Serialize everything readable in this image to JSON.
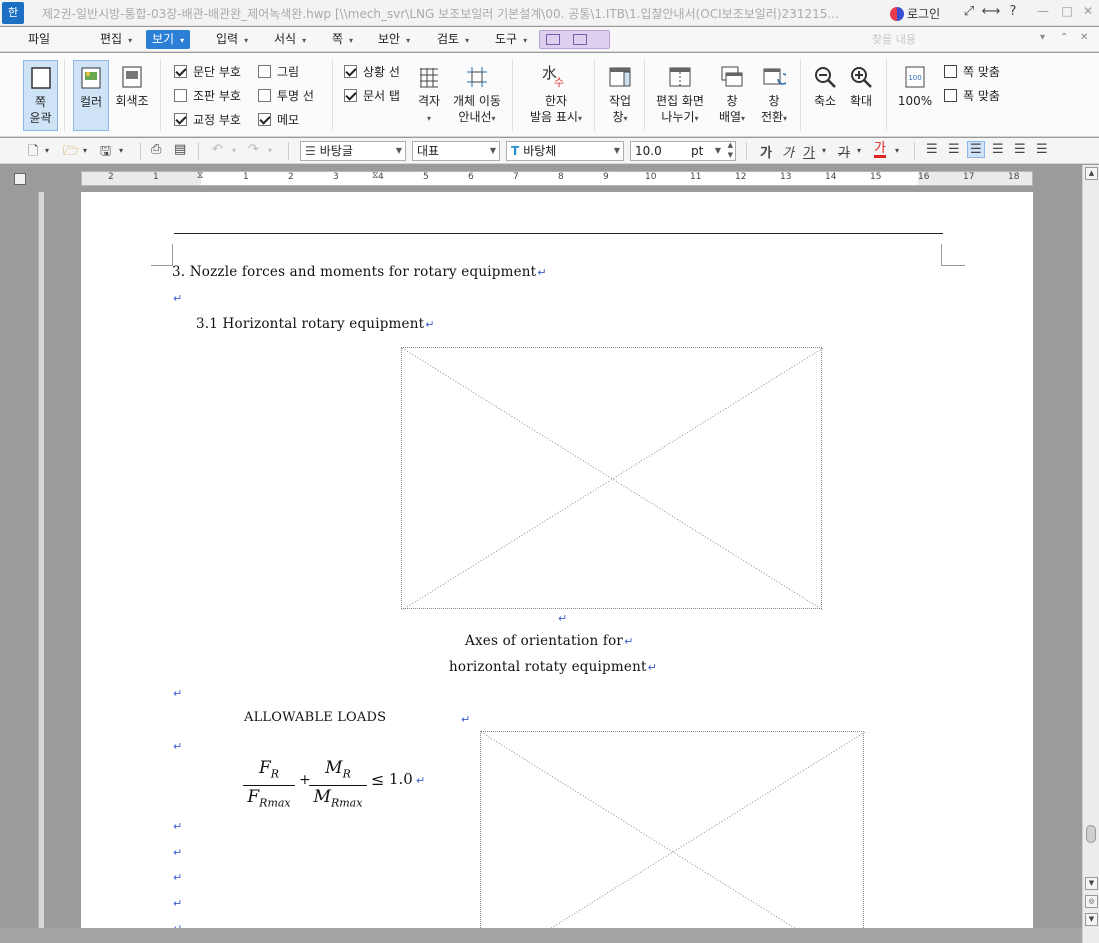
{
  "window": {
    "app_icon": "한",
    "title": "제2권-일반시방-통합-03장-배관-배관완_제어녹색완.hwp [\\\\mech_svr\\LNG 보조보일러 기본설계\\00. 공통\\1.ITB\\1.입찰안내서(OCI보조보일러)231215...",
    "login": "로그인",
    "controls": [
      "⤢",
      "⟷",
      "?"
    ],
    "window_buttons": [
      "—",
      "□",
      "✕"
    ]
  },
  "menubar": {
    "items": [
      {
        "label": "파일",
        "arrow": ""
      },
      {
        "label": "편집",
        "arrow": "▾"
      },
      {
        "label": "보기",
        "arrow": "▾"
      },
      {
        "label": "입력",
        "arrow": "▾"
      },
      {
        "label": "서식",
        "arrow": "▾"
      },
      {
        "label": "쪽",
        "arrow": "▾"
      },
      {
        "label": "보안",
        "arrow": "▾"
      },
      {
        "label": "검토",
        "arrow": "▾"
      },
      {
        "label": "도구",
        "arrow": "▾"
      }
    ],
    "search_placeholder": "찾을 내용",
    "ribbon_toggle": [
      "▾",
      "⌃",
      "✕"
    ]
  },
  "ribbon": {
    "page_outline": {
      "line1": "쪽",
      "line2": "윤곽"
    },
    "color": "컬러",
    "grayscale": "회색조",
    "checks_col1": [
      {
        "label": "문단 부호",
        "checked": true
      },
      {
        "label": "조판 부호",
        "checked": false
      },
      {
        "label": "교정 부호",
        "checked": true
      }
    ],
    "checks_col2": [
      {
        "label": "그림",
        "checked": false
      },
      {
        "label": "투명 선",
        "checked": false
      },
      {
        "label": "메모",
        "checked": true
      }
    ],
    "checks_col3": [
      {
        "label": "상황 선",
        "checked": true
      },
      {
        "label": "문서 탭",
        "checked": true
      }
    ],
    "grid": "격자",
    "obj_move": {
      "line1": "개체 이동",
      "line2": "안내선"
    },
    "hanja": {
      "line1": "한자",
      "line2": "발음 표시"
    },
    "hanja_glyph": "水",
    "hanja_sub": "수",
    "task_pane": {
      "line1": "작업",
      "line2": "창"
    },
    "split_view": {
      "line1": "편집 화면",
      "line2": "나누기"
    },
    "arrange": {
      "line1": "창",
      "line2": "배열"
    },
    "switch": {
      "line1": "창",
      "line2": "전환"
    },
    "zoom_out": "축소",
    "zoom_in": "확대",
    "zoom_level": "100%",
    "fit_page": "쪽 맞춤",
    "fit_width": "폭 맞춤"
  },
  "format_toolbar": {
    "style": "바탕글",
    "lang": "대표",
    "font": "바탕체",
    "size": "10.0",
    "unit": "pt",
    "bold": "가",
    "italic": "가",
    "underline": "가",
    "strike": "가",
    "font_color": "가"
  },
  "ruler": {
    "numbers": [
      "2",
      "1",
      "1",
      "2",
      "3",
      "4",
      "5",
      "6",
      "7",
      "8",
      "9",
      "10",
      "11",
      "12",
      "13",
      "14",
      "15",
      "16",
      "17",
      "18"
    ]
  },
  "document": {
    "heading": "3. Nozzle forces and moments for rotary equipment",
    "subheading": "3.1 Horizontal rotary equipment",
    "caption_line1": "Axes of orientation for",
    "caption_line2": "horizontal rotaty equipment",
    "allowable": "ALLOWABLE LOADS",
    "para_mark": "↵",
    "formula": {
      "num1": "F",
      "num1_sub": "R",
      "den1": "F",
      "den1_sub": "Rmax",
      "plus": "+",
      "num2": "M",
      "num2_sub": "R",
      "den2": "M",
      "den2_sub": "Rmax",
      "leq": "≤",
      "rhs": "1.0"
    }
  },
  "scrollbar": {
    "up": "▲",
    "down": "▼",
    "prev_page": "▲",
    "next_page": "▼",
    "select": "◎"
  }
}
